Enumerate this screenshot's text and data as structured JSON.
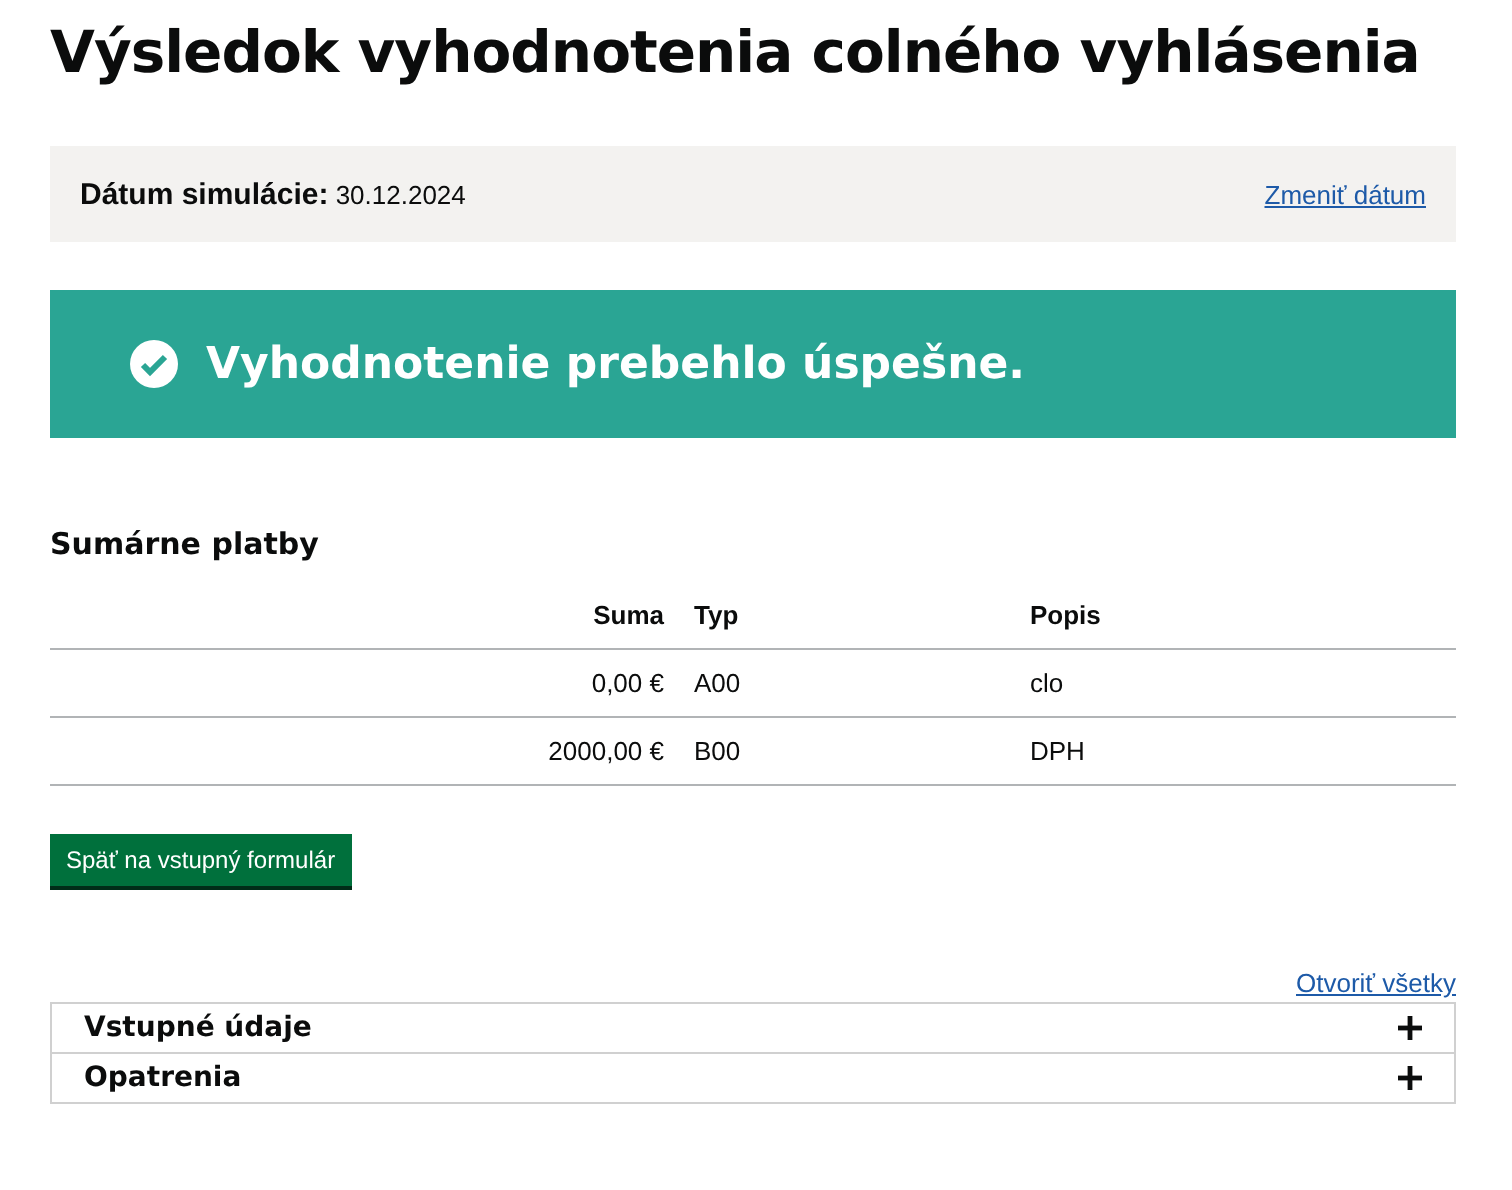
{
  "title": "Výsledok vyhodnotenia colného vyhlásenia",
  "simulation": {
    "label": "Dátum simulácie:",
    "value": "30.12.2024",
    "link": "Zmeniť dátum"
  },
  "banner": {
    "message": "Vyhodnotenie prebehlo úspešne."
  },
  "payments": {
    "heading": "Sumárne platby",
    "columns": [
      "Suma",
      "Typ",
      "Popis"
    ],
    "rows": [
      [
        "0,00 €",
        "A00",
        "clo"
      ],
      [
        "2000,00 €",
        "B00",
        "DPH"
      ]
    ]
  },
  "back_button": "Späť na vstupný formulár",
  "open_all": "Otvoriť všetky",
  "sections": [
    {
      "label": "Vstupné údaje",
      "expanded": false
    },
    {
      "label": "Opatrenia",
      "expanded": false
    }
  ]
}
